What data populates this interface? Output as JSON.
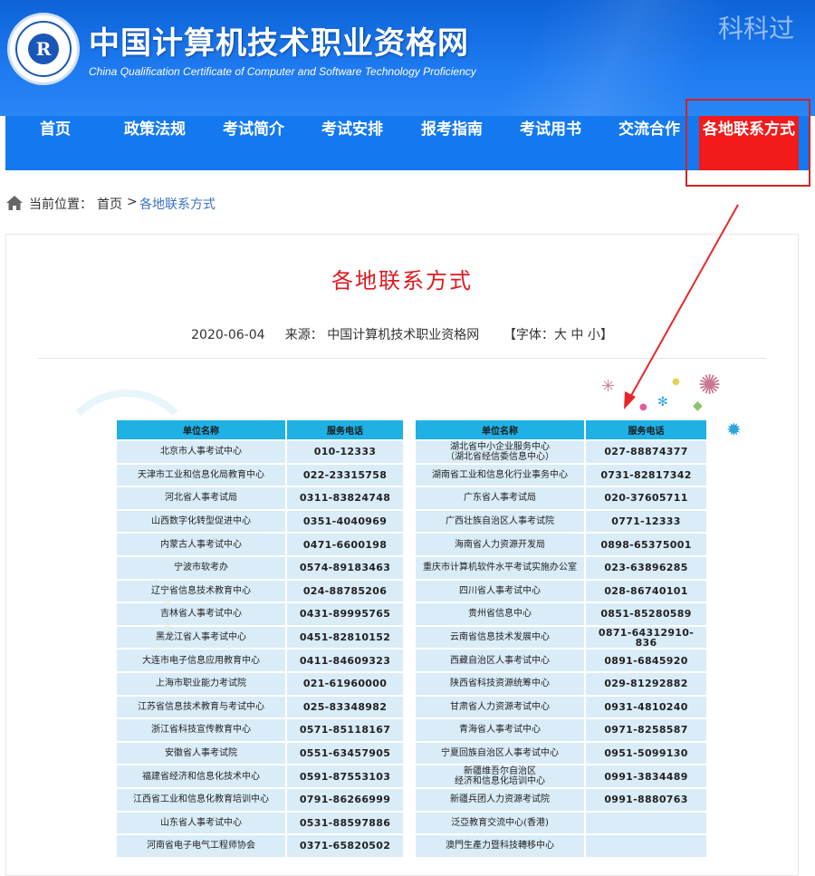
{
  "header": {
    "logo_letter": "R",
    "title": "中国计算机技术职业资格网",
    "subtitle": "China Qualification Certificate of Computer and Software Technology Proficiency",
    "watermark": "科科过"
  },
  "nav": {
    "items": [
      "首页",
      "政策法规",
      "考试简介",
      "考试安排",
      "报考指南",
      "考试用书",
      "交流合作",
      "各地联系方式"
    ],
    "active_index": 7
  },
  "breadcrumb": {
    "prefix": "当前位置：",
    "home": "首页",
    "separator": ">",
    "current": "各地联系方式"
  },
  "article": {
    "title": "各地联系方式",
    "date": "2020-06-04",
    "source_label": "来源：",
    "source": "中国计算机技术职业资格网",
    "font_size_label": "【字体：",
    "font_large": "大",
    "font_medium": "中",
    "font_small": "小",
    "font_close": "】"
  },
  "tables": {
    "col_name": "单位名称",
    "col_phone": "服务电话",
    "left": [
      {
        "name": "北京市人事考试中心",
        "phone": "010-12333"
      },
      {
        "name": "天津市工业和信息化局教育中心",
        "phone": "022-23315758"
      },
      {
        "name": "河北省人事考试局",
        "phone": "0311-83824748"
      },
      {
        "name": "山西数字化转型促进中心",
        "phone": "0351-4040969"
      },
      {
        "name": "内蒙古人事考试中心",
        "phone": "0471-6600198"
      },
      {
        "name": "宁波市软考办",
        "phone": "0574-89183463"
      },
      {
        "name": "辽宁省信息技术教育中心",
        "phone": "024-88785206"
      },
      {
        "name": "吉林省人事考试中心",
        "phone": "0431-89995765"
      },
      {
        "name": "黑龙江省人事考试中心",
        "phone": "0451-82810152"
      },
      {
        "name": "大连市电子信息应用教育中心",
        "phone": "0411-84609323"
      },
      {
        "name": "上海市职业能力考试院",
        "phone": "021-61960000"
      },
      {
        "name": "江苏省信息技术教育与考试中心",
        "phone": "025-83348982"
      },
      {
        "name": "浙江省科技宣传教育中心",
        "phone": "0571-85118167"
      },
      {
        "name": "安徽省人事考试院",
        "phone": "0551-63457905"
      },
      {
        "name": "福建省经济和信息化技术中心",
        "phone": "0591-87553103"
      },
      {
        "name": "江西省工业和信息化教育培训中心",
        "phone": "0791-86266999"
      },
      {
        "name": "山东省人事考试中心",
        "phone": "0531-88597886"
      },
      {
        "name": "河南省电子电气工程师协会",
        "phone": "0371-65820502"
      }
    ],
    "right": [
      {
        "name": "湖北省中小企业服务中心\n（湖北省经信委信息中心）",
        "phone": "027-88874377"
      },
      {
        "name": "湖南省工业和信息化行业事务中心",
        "phone": "0731-82817342"
      },
      {
        "name": "广东省人事考试局",
        "phone": "020-37605711"
      },
      {
        "name": "广西壮族自治区人事考试院",
        "phone": "0771-12333"
      },
      {
        "name": "海南省人力资源开发局",
        "phone": "0898-65375001"
      },
      {
        "name": "重庆市计算机软件水平考试实施办公室",
        "phone": "023-63896285"
      },
      {
        "name": "四川省人事考试中心",
        "phone": "028-86740101"
      },
      {
        "name": "贵州省信息中心",
        "phone": "0851-85280589"
      },
      {
        "name": "云南省信息技术发展中心",
        "phone": "0871-64312910-836"
      },
      {
        "name": "西藏自治区人事考试中心",
        "phone": "0891-6845920"
      },
      {
        "name": "陕西省科技资源统筹中心",
        "phone": "029-81292882"
      },
      {
        "name": "甘肃省人力资源考试中心",
        "phone": "0931-4810240"
      },
      {
        "name": "青海省人事考试中心",
        "phone": "0971-8258587"
      },
      {
        "name": "宁夏回族自治区人事考试中心",
        "phone": "0951-5099130"
      },
      {
        "name": "新疆维吾尔自治区\n经济和信息化培训中心",
        "phone": "0991-3834489"
      },
      {
        "name": "新疆兵团人力资源考试院",
        "phone": "0991-8880763"
      },
      {
        "name": "泛亞教育交流中心(香港)",
        "phone": ""
      },
      {
        "name": "澳門生產力暨科技轉移中心",
        "phone": ""
      }
    ]
  },
  "colors": {
    "header_blue": "#1479f0",
    "active_red": "#f21a1a",
    "title_red": "#e0191e",
    "table_head": "#1fb0e4",
    "table_cell": "#d9ecf8"
  },
  "icons": [
    "home-icon",
    "red-arrow-annotation",
    "sparkle-decoration"
  ]
}
